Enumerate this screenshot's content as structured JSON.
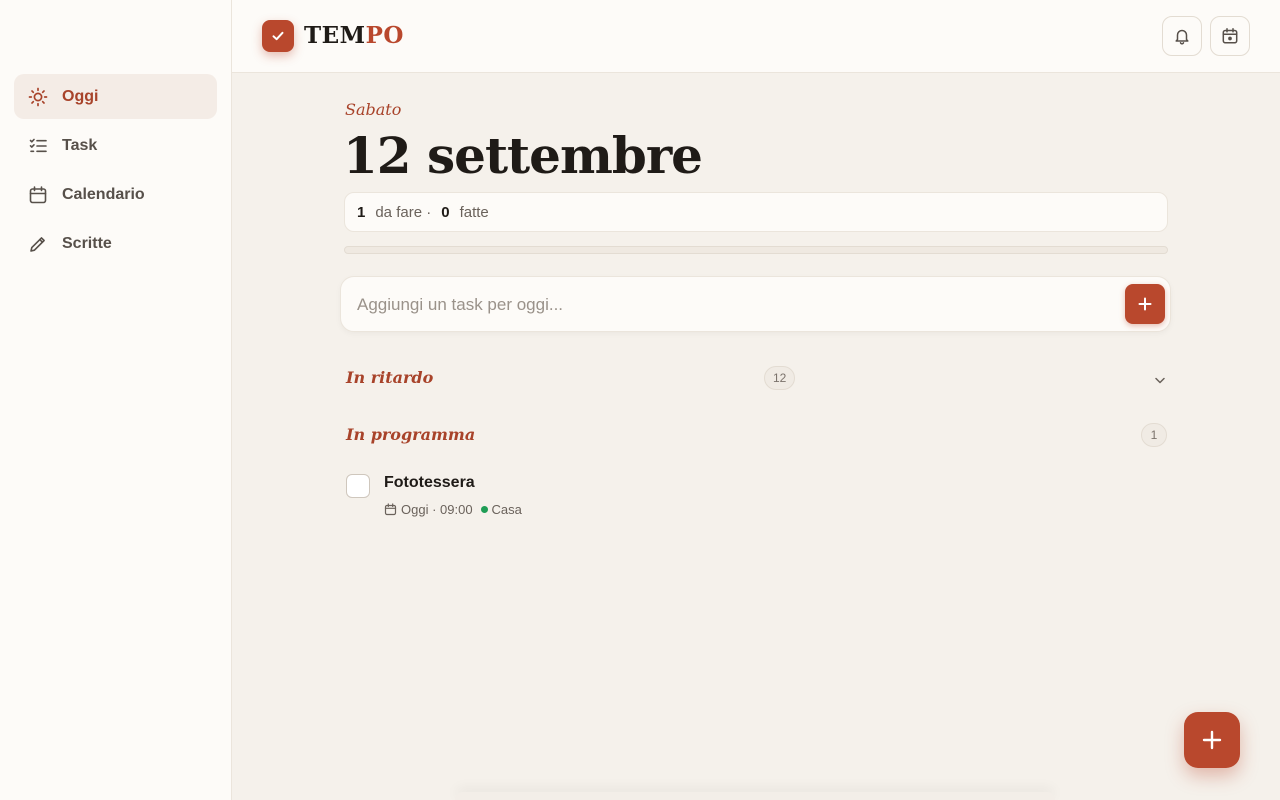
{
  "app": {
    "logo_prefix": "TEM",
    "logo_accent": "PO",
    "accent_color": "#b9482d"
  },
  "sidebar": {
    "items": [
      {
        "label": "Oggi",
        "icon": "sun-icon",
        "active": true
      },
      {
        "label": "Task",
        "icon": "checklist-icon",
        "active": false
      },
      {
        "label": "Calendario",
        "icon": "calendar-icon",
        "active": false
      },
      {
        "label": "Scritte",
        "icon": "pencil-icon",
        "active": false
      }
    ]
  },
  "header": {
    "buttons": [
      {
        "icon": "bell-icon"
      },
      {
        "icon": "calendar-today-icon"
      }
    ]
  },
  "main": {
    "weekday": "Sabato",
    "date": "12 settembre",
    "summary": {
      "todo_count": "1",
      "todo_label": "da fare ·",
      "done_count": "0",
      "done_label": "fatte"
    },
    "progress": 0,
    "add_task": {
      "placeholder": "Aggiungi un task per oggi..."
    },
    "sections": {
      "overdue": {
        "title": "In ritardo",
        "count": "12"
      },
      "scheduled": {
        "title": "In programma",
        "count": "1"
      }
    },
    "tasks": [
      {
        "title": "Fototessera",
        "when": "Oggi · 09:00",
        "tag": "Casa",
        "tag_color": "#1f9d55"
      }
    ]
  }
}
